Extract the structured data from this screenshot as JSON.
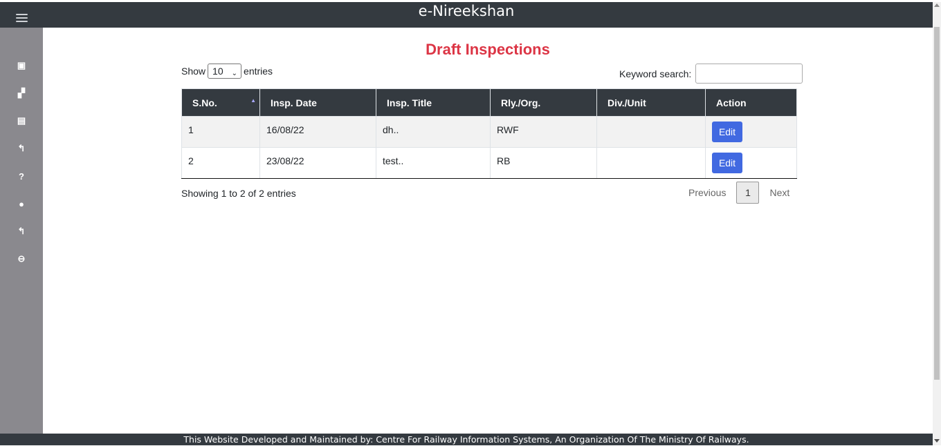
{
  "app": {
    "title": "e-Nireekshan"
  },
  "sidebar": {
    "items": [
      {
        "icon": "dashboard-icon",
        "glyph": "▣"
      },
      {
        "icon": "bookmark-icon",
        "glyph": "▞"
      },
      {
        "icon": "calendar-icon",
        "glyph": "▤"
      },
      {
        "icon": "reply-icon",
        "glyph": "↰"
      },
      {
        "icon": "question-icon",
        "glyph": "?"
      },
      {
        "icon": "help-circle-icon",
        "glyph": "●"
      },
      {
        "icon": "back-icon",
        "glyph": "↰"
      },
      {
        "icon": "logout-icon",
        "glyph": "⊖"
      }
    ]
  },
  "page": {
    "title": "Draft Inspections"
  },
  "controls": {
    "show_label": "Show",
    "entries_value": "10",
    "entries_label": "entries",
    "search_label": "Keyword search:",
    "search_value": ""
  },
  "table": {
    "headers": [
      "S.No.",
      "Insp. Date",
      "Insp. Title",
      "Rly./Org.",
      "Div./Unit",
      "Action"
    ],
    "rows": [
      {
        "sno": "1",
        "date": "16/08/22",
        "title": "dh..",
        "rly": "RWF",
        "div": "",
        "action": "Edit"
      },
      {
        "sno": "2",
        "date": "23/08/22",
        "title": "test..",
        "rly": "RB",
        "div": "",
        "action": "Edit"
      }
    ]
  },
  "pagination": {
    "info": "Showing 1 to 2 of 2 entries",
    "previous": "Previous",
    "current": "1",
    "next": "Next"
  },
  "footer": {
    "text": "This Website Developed and Maintained by: Centre For Railway Information Systems, An Organization Of The Ministry Of Railways."
  },
  "colors": {
    "title_red": "#dc3545",
    "header_dark": "#343a40",
    "button_blue": "#4169e1",
    "sidebar_gray": "#8a898e"
  }
}
